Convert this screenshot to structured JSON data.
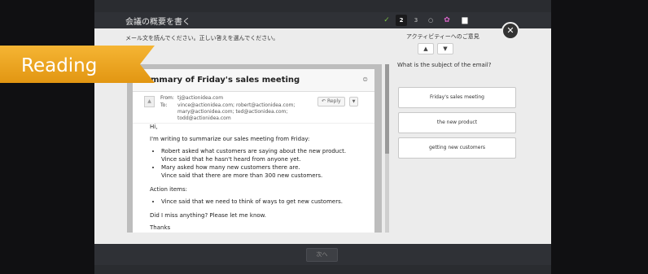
{
  "header": {
    "title": "会議の概要を書く",
    "steps": [
      "✓",
      "2",
      "3",
      "○"
    ],
    "active_step": "2"
  },
  "instructions": "メール文を読んでください。正しい答えを選んでください。",
  "feedback": {
    "label": "アクティビティーへのご意見",
    "thumbs_up": "👍",
    "thumbs_down": "👎"
  },
  "close_label": "✕",
  "ribbon": {
    "label": "Reading",
    "color": "#f0a81b"
  },
  "email": {
    "subject": "mmary of Friday's sales meeting",
    "from_label": "From:",
    "from_value": "tj@actionidea.com",
    "to_label": "To:",
    "to_value": "vince@actionidea.com; robert@actionidea.com; mary@actionidea.com; ted@actionidea.com; todd@actionidea.com",
    "reply_label": "Reply",
    "greeting": "Hi,",
    "intro": "I'm writing to summarize our sales meeting from Friday:",
    "bullets": [
      {
        "line1": "Robert asked what customers are saying about the new product.",
        "line2": "Vince said that he hasn't heard from anyone yet."
      },
      {
        "line1": "Mary asked how many new customers there are.",
        "line2": "Vince said that there are more than 300 new customers."
      }
    ],
    "action_label": "Action items:",
    "action_items": [
      "Vince said that we need to think of ways to get new customers."
    ],
    "closing_question": "Did I miss anything? Please let me know.",
    "signoff": "Thanks"
  },
  "question": {
    "prompt": "What is the subject of the email?",
    "options": [
      "Friday's sales meeting",
      "the new product",
      "getting new customers"
    ]
  },
  "footer": {
    "next_label": "次へ"
  }
}
